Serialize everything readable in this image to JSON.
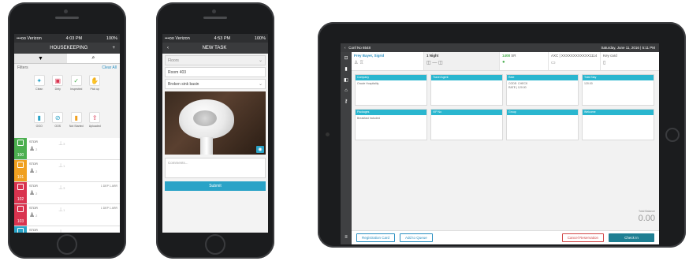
{
  "phone1": {
    "status": {
      "carrier": "•••oo Verizon",
      "time": "4:03 PM",
      "battery": "100%"
    },
    "nav": {
      "title": "HOUSEKEEPING",
      "add": "+"
    },
    "toggle": {
      "filter_icon": "filter-icon",
      "search_icon": "search-icon"
    },
    "filters": {
      "label": "Filters",
      "clear": "Clear All"
    },
    "icons": [
      {
        "label": "Clean",
        "icon": "spray-icon",
        "color": "#2aa3c7"
      },
      {
        "label": "Dirty",
        "icon": "trash-icon",
        "color": "#d9334f"
      },
      {
        "label": "Inspected",
        "icon": "check-icon",
        "color": "#4caf50"
      },
      {
        "label": "Pick up",
        "icon": "hand-icon",
        "color": "#f0a020"
      },
      {
        "label": "OOO",
        "icon": "bottle-icon",
        "color": "#2aa3c7"
      },
      {
        "label": "OOS",
        "icon": "block-icon",
        "color": "#2aa3c7"
      },
      {
        "label": "Not Started",
        "icon": "bottle-icon",
        "color": "#f0a020"
      },
      {
        "label": "Uploaded",
        "icon": "upload-icon",
        "color": "#d9334f"
      }
    ],
    "rooms": [
      {
        "number": "100",
        "type": "STDR",
        "count_a": "2",
        "count_b": "3",
        "color": "#4caf50",
        "extra": ""
      },
      {
        "number": "101",
        "type": "STDR",
        "count_a": "2",
        "count_b": "1",
        "color": "#f0a020",
        "extra": ""
      },
      {
        "number": "102",
        "type": "STDR",
        "count_a": "2",
        "count_b": "3",
        "color": "#d9334f",
        "extra": "1 DEP   1 ARR"
      },
      {
        "number": "103",
        "type": "STDR",
        "count_a": "2",
        "count_b": "1",
        "color": "#d9334f",
        "extra": "1 DEP   1 ARR"
      },
      {
        "number": "",
        "type": "STDR",
        "count_a": "",
        "count_b": "",
        "color": "#2aa3c7",
        "extra": ""
      }
    ]
  },
  "phone2": {
    "status": {
      "carrier": "•••oo Verizon",
      "time": "4:53 PM",
      "battery": "100%"
    },
    "nav": {
      "title": "NEW TASK",
      "back": "‹"
    },
    "floor_placeholder": "Floors",
    "room": "Room 403",
    "issue": "Broken sink basin",
    "comments_placeholder": "Comments...",
    "submit": "Submit"
  },
  "tablet": {
    "top": {
      "back": "‹",
      "conf": "Conf No 6548",
      "datetime": "Saturday, June 11, 2016 | 5:11 PM"
    },
    "guest": {
      "name": "Frey Bayer, Sigrid",
      "nights": "1 Night",
      "room": "1408",
      "room_type": "SR",
      "card": "AXC | XXXXXXXXXXXX1114",
      "key": "Key card"
    },
    "cards": [
      {
        "title": "Company",
        "text": "Oracle Hospitality"
      },
      {
        "title": "Travel Agent",
        "text": ""
      },
      {
        "title": "Rate",
        "text": "CODE: CHECK\nRATE | 120.00"
      },
      {
        "title": "Total Stay",
        "text": "120.00"
      },
      {
        "title": "Packages",
        "text": "Breakfast Included"
      },
      {
        "title": "VIP No",
        "text": ""
      },
      {
        "title": "Group",
        "text": ""
      },
      {
        "title": "Welcome",
        "text": ""
      }
    ],
    "total_label": "Total Balance",
    "total": "0.00",
    "buttons": {
      "registration": "Registration Card",
      "queue": "Add to Queue",
      "cancel": "Cancel Reservation",
      "checkin": "Check In"
    }
  }
}
